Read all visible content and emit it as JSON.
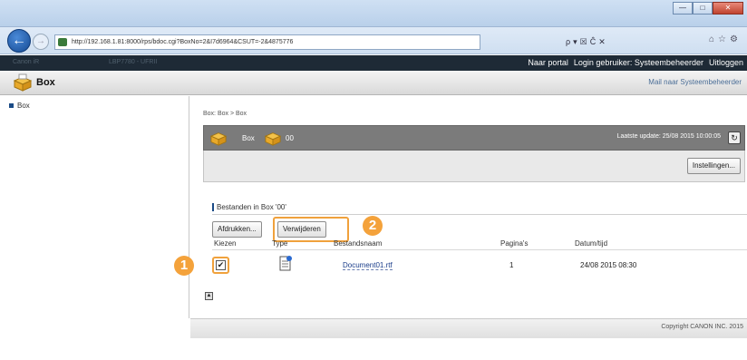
{
  "window": {
    "min": "—",
    "max": "□",
    "close": "✕"
  },
  "browser": {
    "url": "http://192.168.1.81:8000/rps/bdoc.cgi?BoxNo=2&I7d6964&CSUT=-2&4875776",
    "addr_tools": "ρ▾☒Ĉ✕",
    "right_tools": "⌂☆⚙"
  },
  "topbar": {
    "faint1": "Canon iR",
    "faint2": "LBP7780 - UFRII",
    "portal": "Naar portal",
    "login": "Login gebruiker: Systeembeheerder",
    "logout": "Uitloggen"
  },
  "header": {
    "title": "Box",
    "mail": "Mail naar Systeembeheerder"
  },
  "sidebar": {
    "item": "Box"
  },
  "main": {
    "breadcrumb": "Box: Box > Box",
    "panel_title": "Box",
    "box_number": "00",
    "last_update": "Laatste update: 25/08 2015 10:00:05",
    "settings_btn": "Instellingen...",
    "section_title": "Bestanden in Box '00'",
    "print_btn": "Afdrukken...",
    "delete_btn": "Verwijderen"
  },
  "callouts": {
    "one": "1",
    "two": "2"
  },
  "table": {
    "headers": [
      "Kiezen",
      "Type",
      "Bestandsnaam",
      "Pagina's",
      "Datum/tijd"
    ],
    "rows": [
      {
        "checked": "✔",
        "name": "Document01.rtf",
        "pages": "1",
        "datetime": "24/08 2015 08:30"
      }
    ]
  },
  "footer": {
    "copyright": "Copyright CANON INC. 2015"
  }
}
